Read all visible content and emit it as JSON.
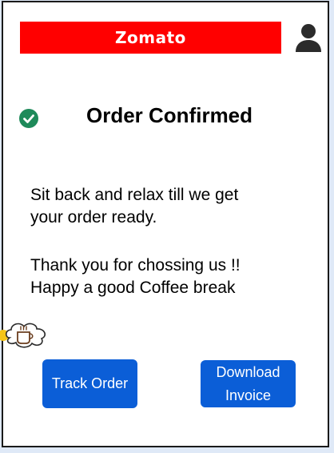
{
  "header": {
    "brand": "Zomato",
    "brand_color": "#ff0000",
    "profile_icon": "user-icon"
  },
  "confirmation": {
    "icon": "check-circle-icon",
    "icon_color": "#1e8a5a",
    "title": "Order Confirmed"
  },
  "messages": {
    "line1": "Sit back and relax till we get",
    "line2": "your order ready.",
    "line3": "Thank you for chossing us !!",
    "line4": "Happy a good Coffee break"
  },
  "decor": {
    "icon": "coffee-cup-icon"
  },
  "actions": {
    "track_label": "Track Order",
    "invoice_label_line1": "Download",
    "invoice_label_line2": "Invoice",
    "button_color": "#0b5ed7"
  }
}
